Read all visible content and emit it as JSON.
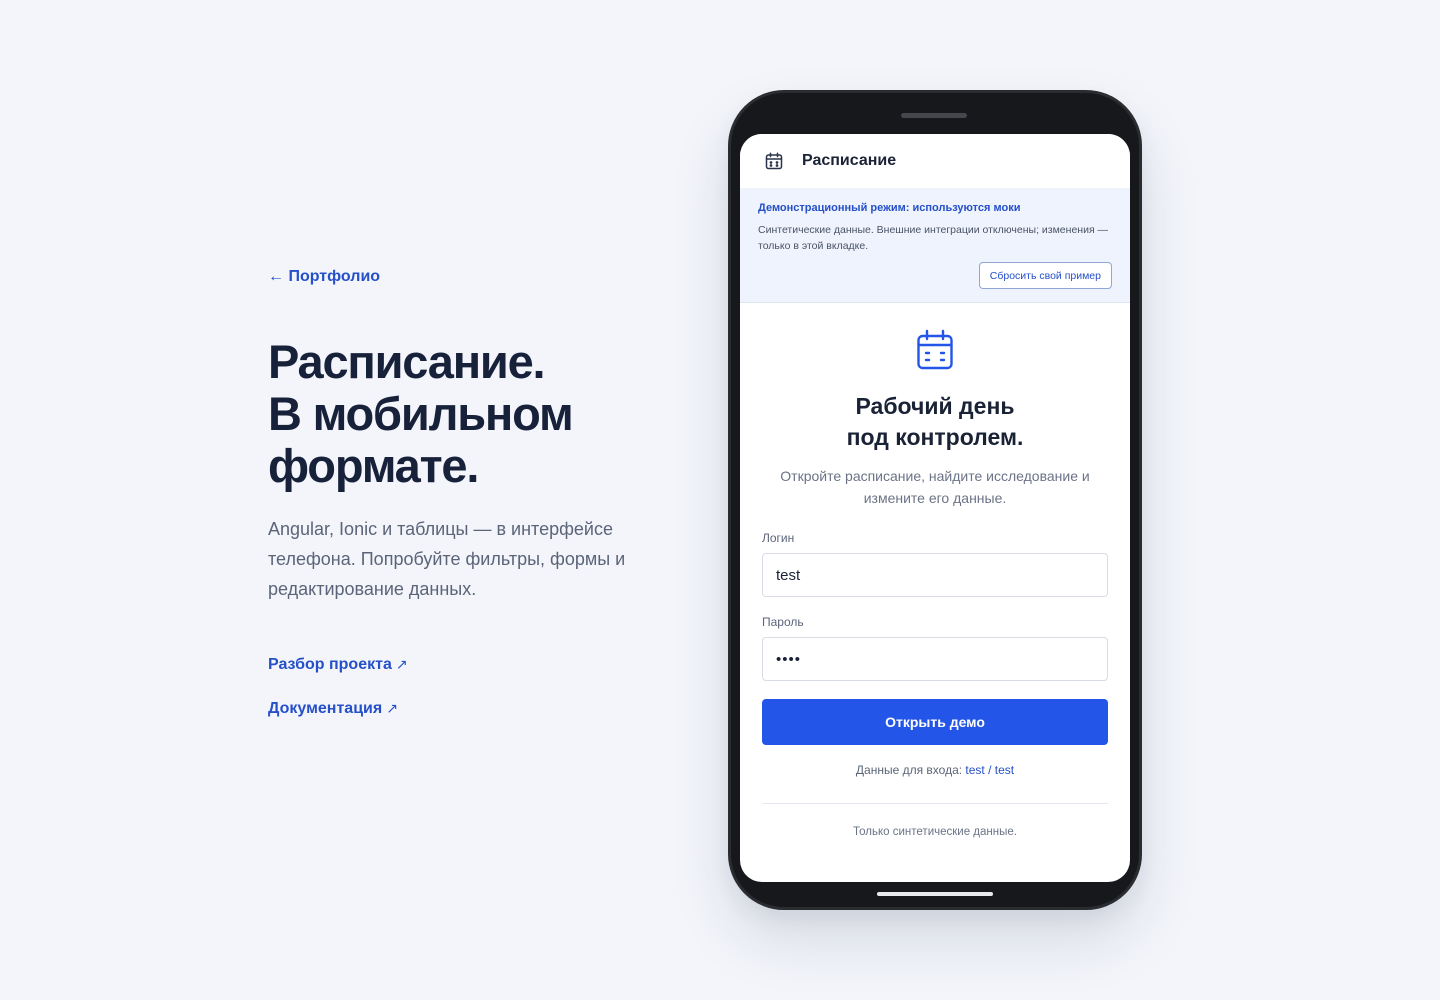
{
  "left": {
    "back_link": "← Портфолио",
    "headline": [
      "Расписание.",
      "В мобильном",
      "формате."
    ],
    "lead": "Angular, Ionic и таблицы — в интерфейсе телефона. Попробуйте фильтры, формы и редактирование данных.",
    "links": [
      {
        "label": "Разбор проекта",
        "arrow": "↗"
      },
      {
        "label": "Документация",
        "arrow": "↗"
      }
    ]
  },
  "app": {
    "header_title": "Расписание",
    "header_icon": "calendar-icon",
    "banner": {
      "title": "Демонстрационный режим: используются моки",
      "text": "Синтетические данные. Внешние интеграции отключены; изменения — только в этой вкладке.",
      "reset_button": "Сбросить свой пример"
    },
    "login": {
      "icon": "calendar-icon",
      "title": [
        "Рабочий день",
        "под контролем."
      ],
      "subtitle": "Откройте расписание, найдите исследование и измените его данные.",
      "login_label": "Логин",
      "login_value": "test",
      "password_label": "Пароль",
      "password_value": "test",
      "submit": "Открыть демо",
      "creds_prefix": "Данные для входа:",
      "creds_value": "test / test",
      "footnote": "Только синтетические данные."
    }
  },
  "colors": {
    "accent": "#2355e8",
    "link": "#2550c8",
    "page_bg": "#f3f5fb",
    "banner_bg": "#eef3fd",
    "phone_frame": "#17181b"
  }
}
